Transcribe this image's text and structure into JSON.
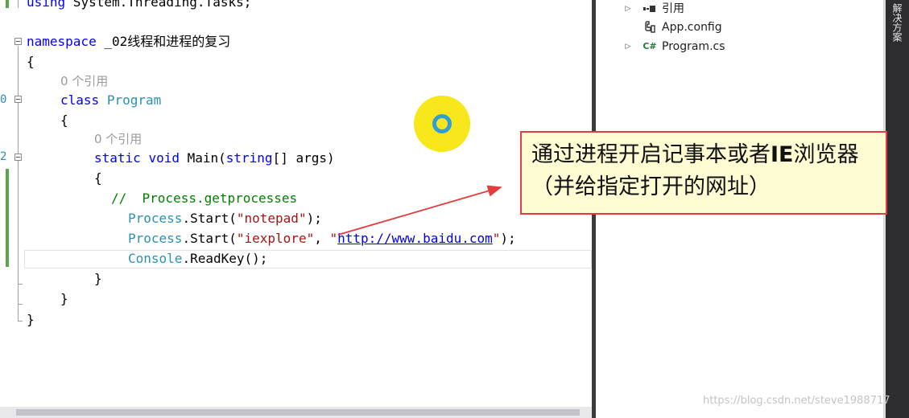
{
  "editor": {
    "gutter_numbers": [
      "0",
      "2"
    ],
    "lines": {
      "using_kw": "using",
      "using_ns": " System.Threading.Tasks;",
      "namespace_kw": "namespace",
      "namespace_name": " _02线程和进程的复习",
      "open_brace_ns": "{",
      "lens_class": "0 个引用",
      "class_kw": "class",
      "class_name": "Program",
      "open_brace_class": "{",
      "lens_main": "0 个引用",
      "static_kw": "static",
      "void_kw": "void",
      "main_name": " Main(",
      "string_kw": "string",
      "main_args": "[] args)",
      "open_brace_main": "{",
      "comment": "//  Process.getprocesses",
      "l1_type": "Process",
      "l1_call": ".Start(",
      "l1_str": "\"notepad\"",
      "l1_end": ");",
      "l2_type": "Process",
      "l2_call": ".Start(",
      "l2_str1": "\"iexplore\"",
      "l2_sep": ", ",
      "l2_q1": "\"",
      "l2_url": "http://www.baidu.com",
      "l2_q2": "\"",
      "l2_end": ");",
      "l3_type": "Console",
      "l3_call": ".ReadKey();",
      "close_brace_main": "}",
      "close_brace_class": "}",
      "close_brace_ns": "}"
    }
  },
  "explorer": {
    "items": [
      {
        "label": "引用",
        "icon": "references-icon",
        "expander": "▷"
      },
      {
        "label": "App.config",
        "icon": "config-file-icon",
        "expander": ""
      },
      {
        "label": "Program.cs",
        "icon": "csharp-file-icon",
        "expander": "▷"
      }
    ]
  },
  "dock_strip": {
    "tab_label": "解决方案"
  },
  "callout": {
    "text_part1": "通过进程开启记事本或者",
    "text_bold": "IE",
    "text_part2": "浏览器（并给指定打开的网址）"
  },
  "watermark": "https://blog.csdn.net/steve1988717",
  "colors": {
    "keyword": "#0000ff",
    "type": "#2b91af",
    "string": "#a31515",
    "comment": "#008000",
    "callout_border": "#e23c3c",
    "callout_fill": "#fdfcd2",
    "cursor_halo": "#f7e71b",
    "cursor_ring": "#2f9fd6",
    "arrow": "#e23c3c"
  }
}
